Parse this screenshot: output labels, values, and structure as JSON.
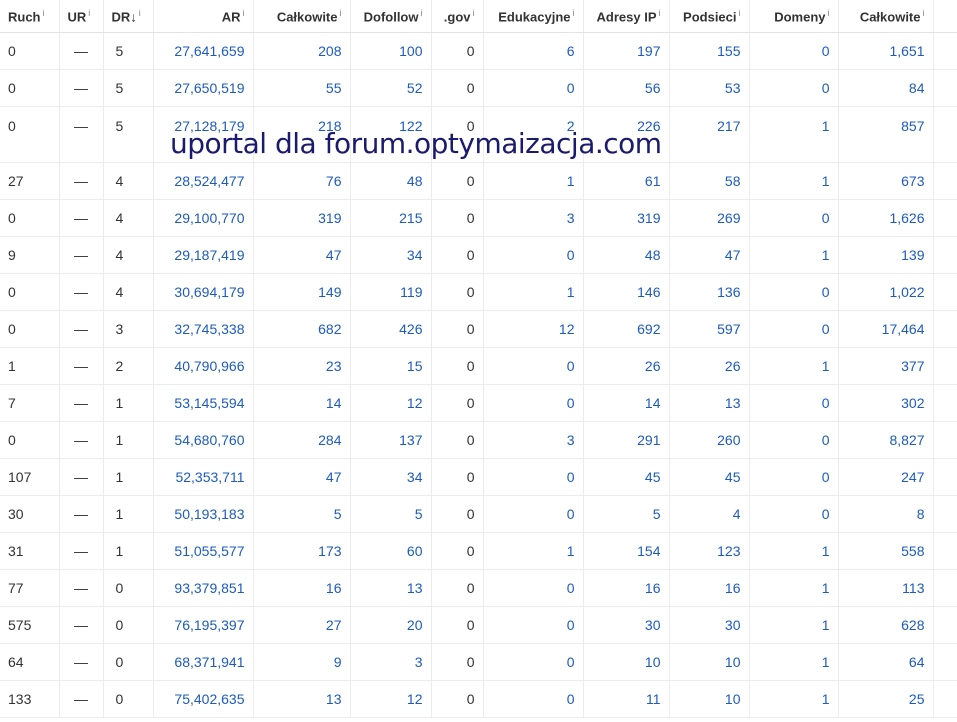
{
  "headers": {
    "ruch": "Ruch",
    "ur": "UR",
    "dr": "DR",
    "dr_sort": "↓",
    "ar": "AR",
    "calkowite": "Całkowite",
    "dofollow": "Dofollow",
    "gov": ".gov",
    "edukacyjne": "Edukacyjne",
    "adresy_ip": "Adresy IP",
    "podsieci": "Podsieci",
    "domeny": "Domeny",
    "calkowite2": "Całkowite",
    "info": "i"
  },
  "overlay_text": "uportal dla forum.optymaizacja.com",
  "rows": [
    {
      "ruch": "0",
      "ur": "—",
      "dr": "5",
      "ar": "27,641,659",
      "calkowite": "208",
      "dofollow": "100",
      "gov": "0",
      "edu": "6",
      "ip": "197",
      "podsieci": "155",
      "domeny": "0",
      "calkowite2": "1,651"
    },
    {
      "ruch": "0",
      "ur": "—",
      "dr": "5",
      "ar": "27,650,519",
      "calkowite": "55",
      "dofollow": "52",
      "gov": "0",
      "edu": "0",
      "ip": "56",
      "podsieci": "53",
      "domeny": "0",
      "calkowite2": "84"
    },
    {
      "ruch": "0",
      "ur": "—",
      "dr": "5",
      "ar": "27,128,179",
      "calkowite": "218",
      "dofollow": "122",
      "gov": "0",
      "edu": "2",
      "ip": "226",
      "podsieci": "217",
      "domeny": "1",
      "calkowite2": "857"
    },
    {
      "ruch": "27",
      "ur": "—",
      "dr": "4",
      "ar": "28,524,477",
      "calkowite": "76",
      "dofollow": "48",
      "gov": "0",
      "edu": "1",
      "ip": "61",
      "podsieci": "58",
      "domeny": "1",
      "calkowite2": "673"
    },
    {
      "ruch": "0",
      "ur": "—",
      "dr": "4",
      "ar": "29,100,770",
      "calkowite": "319",
      "dofollow": "215",
      "gov": "0",
      "edu": "3",
      "ip": "319",
      "podsieci": "269",
      "domeny": "0",
      "calkowite2": "1,626"
    },
    {
      "ruch": "9",
      "ur": "—",
      "dr": "4",
      "ar": "29,187,419",
      "calkowite": "47",
      "dofollow": "34",
      "gov": "0",
      "edu": "0",
      "ip": "48",
      "podsieci": "47",
      "domeny": "1",
      "calkowite2": "139"
    },
    {
      "ruch": "0",
      "ur": "—",
      "dr": "4",
      "ar": "30,694,179",
      "calkowite": "149",
      "dofollow": "119",
      "gov": "0",
      "edu": "1",
      "ip": "146",
      "podsieci": "136",
      "domeny": "0",
      "calkowite2": "1,022"
    },
    {
      "ruch": "0",
      "ur": "—",
      "dr": "3",
      "ar": "32,745,338",
      "calkowite": "682",
      "dofollow": "426",
      "gov": "0",
      "edu": "12",
      "ip": "692",
      "podsieci": "597",
      "domeny": "0",
      "calkowite2": "17,464"
    },
    {
      "ruch": "1",
      "ur": "—",
      "dr": "2",
      "ar": "40,790,966",
      "calkowite": "23",
      "dofollow": "15",
      "gov": "0",
      "edu": "0",
      "ip": "26",
      "podsieci": "26",
      "domeny": "1",
      "calkowite2": "377"
    },
    {
      "ruch": "7",
      "ur": "—",
      "dr": "1",
      "ar": "53,145,594",
      "calkowite": "14",
      "dofollow": "12",
      "gov": "0",
      "edu": "0",
      "ip": "14",
      "podsieci": "13",
      "domeny": "0",
      "calkowite2": "302"
    },
    {
      "ruch": "0",
      "ur": "—",
      "dr": "1",
      "ar": "54,680,760",
      "calkowite": "284",
      "dofollow": "137",
      "gov": "0",
      "edu": "3",
      "ip": "291",
      "podsieci": "260",
      "domeny": "0",
      "calkowite2": "8,827"
    },
    {
      "ruch": "107",
      "ur": "—",
      "dr": "1",
      "ar": "52,353,711",
      "calkowite": "47",
      "dofollow": "34",
      "gov": "0",
      "edu": "0",
      "ip": "45",
      "podsieci": "45",
      "domeny": "0",
      "calkowite2": "247"
    },
    {
      "ruch": "30",
      "ur": "—",
      "dr": "1",
      "ar": "50,193,183",
      "calkowite": "5",
      "dofollow": "5",
      "gov": "0",
      "edu": "0",
      "ip": "5",
      "podsieci": "4",
      "domeny": "0",
      "calkowite2": "8"
    },
    {
      "ruch": "31",
      "ur": "—",
      "dr": "1",
      "ar": "51,055,577",
      "calkowite": "173",
      "dofollow": "60",
      "gov": "0",
      "edu": "1",
      "ip": "154",
      "podsieci": "123",
      "domeny": "1",
      "calkowite2": "558"
    },
    {
      "ruch": "77",
      "ur": "—",
      "dr": "0",
      "ar": "93,379,851",
      "calkowite": "16",
      "dofollow": "13",
      "gov": "0",
      "edu": "0",
      "ip": "16",
      "podsieci": "16",
      "domeny": "1",
      "calkowite2": "113"
    },
    {
      "ruch": "575",
      "ur": "—",
      "dr": "0",
      "ar": "76,195,397",
      "calkowite": "27",
      "dofollow": "20",
      "gov": "0",
      "edu": "0",
      "ip": "30",
      "podsieci": "30",
      "domeny": "1",
      "calkowite2": "628"
    },
    {
      "ruch": "64",
      "ur": "—",
      "dr": "0",
      "ar": "68,371,941",
      "calkowite": "9",
      "dofollow": "3",
      "gov": "0",
      "edu": "0",
      "ip": "10",
      "podsieci": "10",
      "domeny": "1",
      "calkowite2": "64"
    },
    {
      "ruch": "133",
      "ur": "—",
      "dr": "0",
      "ar": "75,402,635",
      "calkowite": "13",
      "dofollow": "12",
      "gov": "0",
      "edu": "0",
      "ip": "11",
      "podsieci": "10",
      "domeny": "1",
      "calkowite2": "25"
    }
  ]
}
